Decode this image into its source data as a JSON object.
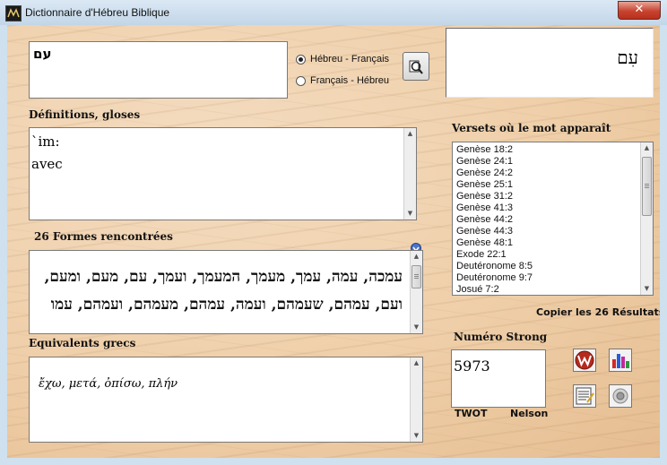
{
  "window": {
    "title": "Dictionnaire d'Hébreu Biblique",
    "close_label": "✕"
  },
  "search": {
    "input_value": "עם",
    "direction_options": [
      "Hébreu - Français",
      "Français - Hébreu"
    ],
    "selected_direction": "Hébreu - Français",
    "display_word": "עִם"
  },
  "definitions": {
    "label": "Définitions, gloses",
    "lines": [
      "`im:",
      "avec"
    ]
  },
  "forms": {
    "label": "26 Formes rencontrées",
    "text": "עמכה, עמה, עמך, מעמך, המעמך, ועמך, עם, מעם, ומעם, ועם, עמהם, שעמהם, ועמה, עמהם, מעמהם, ועמהם, עמו"
  },
  "greek": {
    "label": "Equivalents grecs",
    "text": "ἔχω, μετά, ὀπίσω, πλήν"
  },
  "verses": {
    "label": "Versets où le mot apparaît",
    "items": [
      "Genèse 18:2",
      "Genèse 24:1",
      "Genèse 24:2",
      "Genèse 25:1",
      "Genèse 31:2",
      "Genèse 41:3",
      "Genèse 44:2",
      "Genèse 44:3",
      "Genèse 48:1",
      "Exode 22:1",
      "Deutéronome 8:5",
      "Deutéronome 9:7",
      "Josué 7:2"
    ],
    "copy_label": "Copier les 26 Résultats"
  },
  "strong": {
    "label": "Numéro Strong",
    "value": "5973",
    "twot_label": "TWOT",
    "nelson_label": "Nelson"
  },
  "colors": {
    "parchment": "#efcfa9",
    "titlebar": "#cfe0ee",
    "close": "#c7432f"
  },
  "icons": [
    "magnifier-icon",
    "scroll-down-icon",
    "w-logo-icon",
    "bar-chart-icon",
    "notepad-icon",
    "speaker-icon"
  ]
}
